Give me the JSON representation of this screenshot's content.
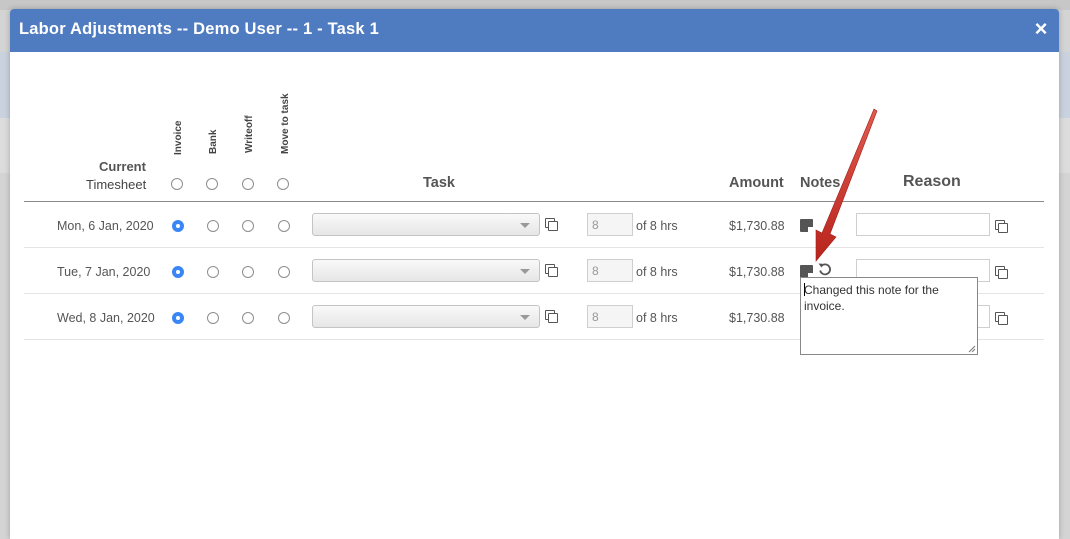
{
  "modal": {
    "title": "Labor Adjustments -- Demo User -- 1 - Task 1",
    "close_glyph": "×"
  },
  "headers": {
    "current": "Current",
    "timesheet": "Timesheet",
    "invoice": "Invoice",
    "bank": "Bank",
    "writeoff": "Writeoff",
    "move_to_task": "Move to task",
    "task": "Task",
    "amount": "Amount",
    "notes": "Notes",
    "reason": "Reason"
  },
  "rows": [
    {
      "date": "Mon, 6 Jan, 2020",
      "selected": "invoice",
      "task": "",
      "hours": "8",
      "of_hours": "of 8 hrs",
      "amount": "$1,730.88",
      "reason": ""
    },
    {
      "date": "Tue, 7 Jan, 2020",
      "selected": "invoice",
      "task": "",
      "hours": "8",
      "of_hours": "of 8 hrs",
      "amount": "$1,730.88",
      "reason": ""
    },
    {
      "date": "Wed, 8 Jan, 2020",
      "selected": "invoice",
      "task": "",
      "hours": "8",
      "of_hours": "of 8 hrs",
      "amount": "$1,730.88",
      "reason": ""
    }
  ],
  "note_popup": {
    "text": "Changed this note for the invoice."
  },
  "colors": {
    "header_bg": "#4f7bc0",
    "radio_selected": "#3a86f5",
    "arrow": "#d0342c"
  },
  "icons": [
    "close-icon",
    "copy-icon",
    "note-icon",
    "undo-icon",
    "chevron-down-icon"
  ]
}
